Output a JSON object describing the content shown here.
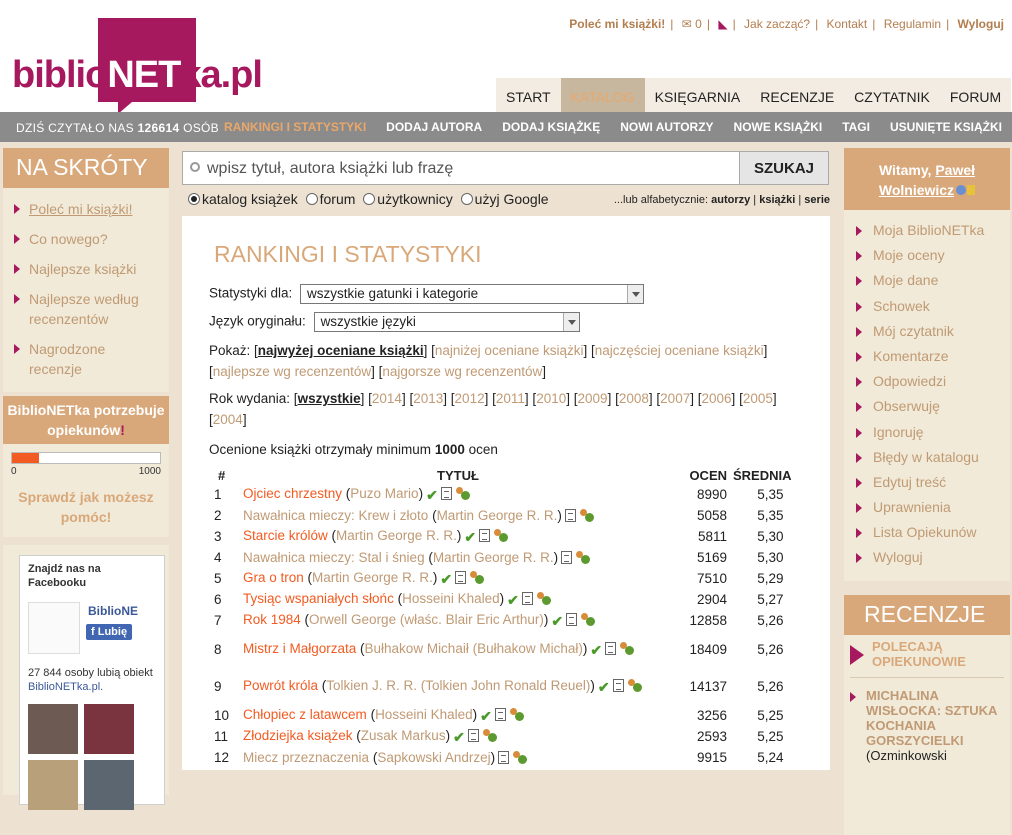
{
  "logo": {
    "prefix": "biblio",
    "net": "NET",
    "suffix": "ka.pl"
  },
  "toplinks": {
    "polec": "Poleć mi książki!",
    "mail_count": "0",
    "jak": "Jak zacząć?",
    "kontakt": "Kontakt",
    "regulamin": "Regulamin",
    "wyloguj": "Wyloguj"
  },
  "mainnav": [
    "START",
    "KATALOG",
    "KSIĘGARNIA",
    "RECENZJE",
    "CZYTATNIK",
    "FORUM"
  ],
  "subnav": {
    "stat_prefix": "DZIŚ CZYTAŁO NAS",
    "stat_count": "126614",
    "stat_suffix": "OSÓB",
    "items": [
      "RANKINGI I STATYSTYKI",
      "DODAJ AUTORA",
      "DODAJ KSIĄŻKĘ",
      "NOWI AUTORZY",
      "NOWE KSIĄŻKI",
      "TAGI",
      "USUNIĘTE KSIĄŻKI"
    ]
  },
  "left": {
    "title": "NA SKRÓTY",
    "items": [
      "Poleć mi książki!",
      "Co nowego?",
      "Najlepsze książki",
      "Najlepsze według recenzentów",
      "Nagrodzone recenzje"
    ],
    "opiek_line1": "BiblioNETka potrzebuje",
    "opiek_line2": "opiekunów",
    "opiek_bang": "!",
    "progress": {
      "value": 180,
      "min": "0",
      "max": "1000"
    },
    "check": "Sprawdź jak możesz pomóc!",
    "fb": {
      "title": "Znajdź nas na Facebooku",
      "name": "BiblioNE",
      "like": "Lubię",
      "likes_text": "27 844 osoby lubią obiekt",
      "likes_link": "BiblioNETka.pl."
    }
  },
  "search": {
    "placeholder": "wpisz tytuł, autora książki lub frazę",
    "button": "SZUKAJ",
    "radios": [
      "katalog książek",
      "forum",
      "użytkownicy",
      "użyj Google"
    ],
    "alpha_prefix": "...lub alfabetycznie:",
    "alpha": [
      "autorzy",
      "książki",
      "serie"
    ]
  },
  "panel": {
    "title": "RANKINGI I STATYSTYKI",
    "stat_label": "Statystyki dla:",
    "stat_value": "wszystkie gatunki i kategorie",
    "lang_label": "Język oryginału:",
    "lang_value": "wszystkie języki",
    "show_label": "Pokaż:",
    "show_selected": "najwyżej oceniane książki",
    "show_opts": [
      "najniżej oceniane książki",
      "najczęściej oceniane książki",
      "najlepsze wg recenzentów",
      "najgorsze wg recenzentów"
    ],
    "year_label": "Rok wydania:",
    "year_selected": "wszystkie",
    "years": [
      "2014",
      "2013",
      "2012",
      "2011",
      "2010",
      "2009",
      "2008",
      "2007",
      "2006",
      "2005",
      "2004"
    ],
    "min_prefix": "Ocenione książki otrzymały minimum",
    "min_value": "1000",
    "min_suffix": "ocen",
    "cols": [
      "#",
      "TYTUŁ",
      "OCEN",
      "ŚREDNIA"
    ],
    "rows": [
      {
        "n": "1",
        "title": "Ojciec chrzestny",
        "author": "Puzo Mario",
        "ocen": "8990",
        "avg": "5,35",
        "hl": true
      },
      {
        "n": "2",
        "title": "Nawałnica mieczy: Krew i złoto",
        "author": "Martin George R. R.",
        "ocen": "5058",
        "avg": "5,35",
        "hl": false
      },
      {
        "n": "3",
        "title": "Starcie królów",
        "author": "Martin George R. R.",
        "ocen": "5811",
        "avg": "5,30",
        "hl": true
      },
      {
        "n": "4",
        "title": "Nawałnica mieczy: Stal i śnieg",
        "author": "Martin George R. R.",
        "ocen": "5169",
        "avg": "5,30",
        "hl": false
      },
      {
        "n": "5",
        "title": "Gra o tron",
        "author": "Martin George R. R.",
        "ocen": "7510",
        "avg": "5,29",
        "hl": true
      },
      {
        "n": "6",
        "title": "Tysiąc wspaniałych słońc",
        "author": "Hosseini Khaled",
        "ocen": "2904",
        "avg": "5,27",
        "hl": true
      },
      {
        "n": "7",
        "title": "Rok 1984",
        "author": "Orwell George (właśc. Blair Eric Arthur)",
        "ocen": "12858",
        "avg": "5,26",
        "hl": true
      },
      {
        "n": "8",
        "title": "Mistrz i Małgorzata",
        "author": "Bułhakow Michaił (Bułhakow Michał)",
        "ocen": "18409",
        "avg": "5,26",
        "hl": true
      },
      {
        "n": "9",
        "title": "Powrót króla",
        "author": "Tolkien J. R. R. (Tolkien John Ronald Reuel)",
        "ocen": "14137",
        "avg": "5,26",
        "hl": true
      },
      {
        "n": "10",
        "title": "Chłopiec z latawcem",
        "author": "Hosseini Khaled",
        "ocen": "3256",
        "avg": "5,25",
        "hl": true
      },
      {
        "n": "11",
        "title": "Złodziejka książek",
        "author": "Zusak Markus",
        "ocen": "2593",
        "avg": "5,25",
        "hl": true
      },
      {
        "n": "12",
        "title": "Miecz przeznaczenia",
        "author": "Sapkowski Andrzej",
        "ocen": "9915",
        "avg": "5,24",
        "hl": false
      }
    ]
  },
  "right": {
    "welcome": "Witamy,",
    "user": "Paweł Wolniewicz",
    "items": [
      "Moja BiblioNETka",
      "Moje oceny",
      "Moje dane",
      "Schowek",
      "Mój czytatnik",
      "Komentarze",
      "Odpowiedzi",
      "Obserwuję",
      "Ignoruję",
      "Błędy w katalogu",
      "Edytuj treść",
      "Uprawnienia",
      "Lista Opiekunów",
      "Wyloguj"
    ],
    "rec_title": "RECENZJE",
    "polecaja": "POLECAJĄ OPIEKUNOWIE",
    "review_title": "MICHALINA WISŁOCKA: SZTUKA KOCHANIA GORSZYCIELKI",
    "review_by": "(Ozminkowski"
  },
  "colors": {
    "brand": "#a6195e",
    "accent": "#d9a87a",
    "link": "#c09a74",
    "title_link": "#f25b21"
  }
}
